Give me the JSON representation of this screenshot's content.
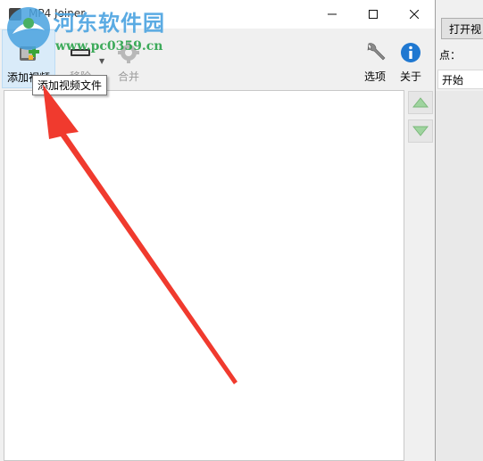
{
  "window": {
    "title": "MP4 Joiner",
    "controls": {
      "minimize_icon": "minimize-icon",
      "maximize_icon": "maximize-icon",
      "close_icon": "close-icon"
    }
  },
  "toolbar": {
    "add_video": "添加视频",
    "remove": "移除",
    "merge": "合并",
    "options": "选项",
    "about": "关于"
  },
  "tooltip": {
    "text": "添加视频文件"
  },
  "background_app": {
    "open_button": "打开视",
    "label": "点：",
    "field_value": "开始"
  },
  "watermark": {
    "title": "河东软件园",
    "url": "www.pc0359.cn"
  },
  "colors": {
    "arrow": "#f03a2e",
    "accent": "#d9ebf9",
    "watermark_blue": "#4aa3e0",
    "watermark_green": "#2aa34a"
  }
}
